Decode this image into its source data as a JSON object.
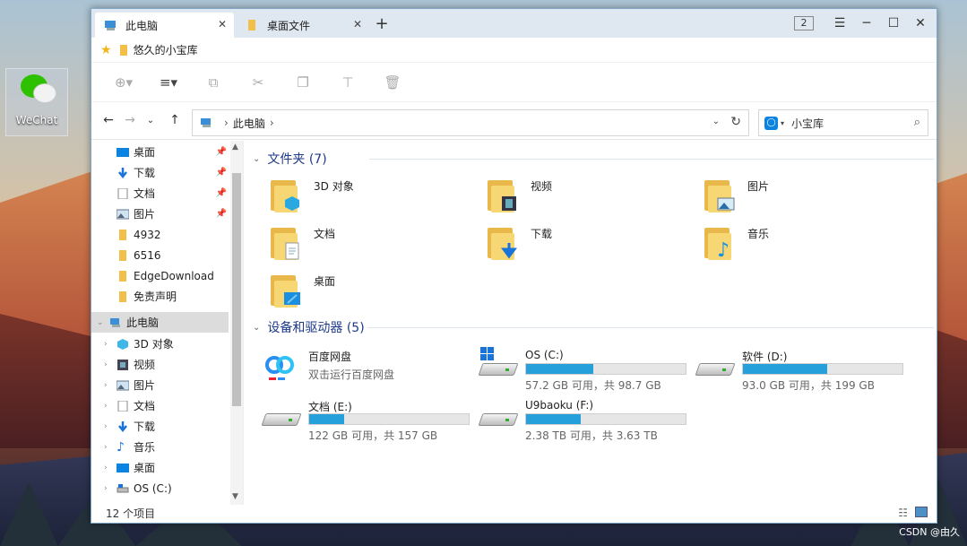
{
  "desktop": {
    "icon_label": "WeChat",
    "watermark": "CSDN @由久"
  },
  "tabs": [
    {
      "label": "此电脑",
      "active": true
    },
    {
      "label": "桌面文件",
      "active": false
    }
  ],
  "titlebar": {
    "window_count": "2"
  },
  "favorites": {
    "item": "悠久的小宝库"
  },
  "address": {
    "segment": "此电脑"
  },
  "search": {
    "scope": "小宝库"
  },
  "sidebar": {
    "quick": [
      {
        "label": "桌面",
        "pinned": true
      },
      {
        "label": "下载",
        "pinned": true
      },
      {
        "label": "文档",
        "pinned": true
      },
      {
        "label": "图片",
        "pinned": true
      },
      {
        "label": "4932",
        "pinned": false
      },
      {
        "label": "6516",
        "pinned": false
      },
      {
        "label": "EdgeDownload",
        "pinned": false
      },
      {
        "label": "免责声明",
        "pinned": false
      }
    ],
    "this_pc": "此电脑",
    "pc_children": [
      "3D 对象",
      "视频",
      "图片",
      "文档",
      "下载",
      "音乐",
      "桌面",
      "OS (C:)"
    ]
  },
  "content": {
    "folders_header": "文件夹 (7)",
    "folders": [
      "3D 对象",
      "视频",
      "图片",
      "文档",
      "下载",
      "音乐",
      "桌面"
    ],
    "drives_header": "设备和驱动器 (5)",
    "baidu": {
      "name": "百度网盘",
      "sub": "双击运行百度网盘"
    },
    "drives": [
      {
        "name": "OS (C:)",
        "free": "57.2 GB 可用，共 98.7 GB",
        "used_fraction": 0.42
      },
      {
        "name": "软件 (D:)",
        "free": "93.0 GB 可用，共 199 GB",
        "used_fraction": 0.53
      },
      {
        "name": "文档 (E:)",
        "free": "122 GB 可用，共 157 GB",
        "used_fraction": 0.22
      },
      {
        "name": "U9baoku (F:)",
        "free": "2.38 TB 可用，共 3.63 TB",
        "used_fraction": 0.34
      }
    ]
  },
  "status": {
    "count": "12 个项目"
  },
  "colors": {
    "drive_bar": "#26a0da",
    "group_header": "#1e3a8a",
    "folder": "#f7d774"
  }
}
